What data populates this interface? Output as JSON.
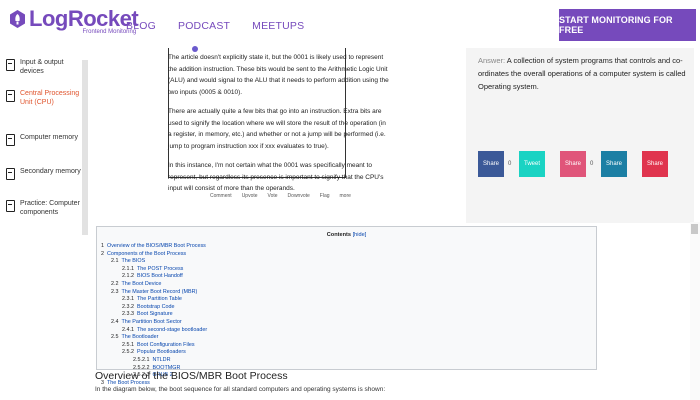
{
  "header": {
    "logo_text": "LogRocket",
    "logo_tagline": "Frontend Monitoring",
    "nav": [
      "BLOG",
      "PODCAST",
      "MEETUPS"
    ],
    "cta_label": "START MONITORING FOR FREE",
    "brand_color": "#764abc"
  },
  "sidebar": {
    "items": [
      {
        "label": "Input & output devices",
        "active": false
      },
      {
        "label": "Central Processing Unit (CPU)",
        "active": true
      },
      {
        "label": "Computer memory",
        "active": false
      },
      {
        "label": "Secondary memory",
        "active": false
      },
      {
        "label": "Practice: Computer components",
        "active": false
      }
    ],
    "icon": "document-icon",
    "active_color": "#e0552e"
  },
  "document": {
    "paragraphs": [
      "The article doesn't explicitly state it, but the 0001 is likely used to represent the addition instruction. These bits would be sent to the Arithmetic Logic Unit (ALU) and would signal to the ALU that it needs to perform addition using the two inputs (0005 & 0010).",
      "There are actually quite a few bits that go into an instruction. Extra bits are used to signify the location where we will store the result of the operation (in a register, in memory, etc.) and whether or not a jump will be performed (i.e. jump to program instruction xxx if xxx evaluates to true).",
      "In this instance, I'm not certain what the 0001 was specifically meant to represent, but regardless its presence is important to signify that the CPU's input will consist of more than the operands."
    ],
    "toolbar": [
      "Comment",
      "Upvote",
      "Vote",
      "Downvote",
      "Flag",
      "more"
    ]
  },
  "answer": {
    "label": "Answer:",
    "text": "A collection of system programs that controls and co-ordinates the overall operations of a computer system is called Operating system."
  },
  "share": {
    "buttons": [
      {
        "label": "Share",
        "count": "0",
        "color": "#3b5998"
      },
      {
        "label": "Tweet",
        "count": "",
        "color": "#1ad3c3"
      },
      {
        "label": "Share",
        "count": "0",
        "color": "#e0557a"
      },
      {
        "label": "Share",
        "count": "",
        "color": "#1c7fa4"
      },
      {
        "label": "Share",
        "count": "",
        "color": "#e0344e"
      }
    ]
  },
  "toc": {
    "title": "Contents",
    "hide_label": "[hide]",
    "entries": [
      {
        "num": "1",
        "text": "Overview of the BIOS/MBR Boot Process",
        "level": 0
      },
      {
        "num": "2",
        "text": "Components of the Boot Process",
        "level": 0
      },
      {
        "num": "2.1",
        "text": "The BIOS",
        "level": 1
      },
      {
        "num": "2.1.1",
        "text": "The POST Process",
        "level": 2
      },
      {
        "num": "2.1.2",
        "text": "BIOS Boot Handoff",
        "level": 2
      },
      {
        "num": "2.2",
        "text": "The Boot Device",
        "level": 1
      },
      {
        "num": "2.3",
        "text": "The Master Boot Record (MBR)",
        "level": 1
      },
      {
        "num": "2.3.1",
        "text": "The Partition Table",
        "level": 2
      },
      {
        "num": "2.3.2",
        "text": "Bootstrap Code",
        "level": 2
      },
      {
        "num": "2.3.3",
        "text": "Boot Signature",
        "level": 2
      },
      {
        "num": "2.4",
        "text": "The Partition Boot Sector",
        "level": 1
      },
      {
        "num": "2.4.1",
        "text": "The second-stage bootloader",
        "level": 2
      },
      {
        "num": "2.5",
        "text": "The Bootloader",
        "level": 1
      },
      {
        "num": "2.5.1",
        "text": "Boot Configuration Files",
        "level": 2
      },
      {
        "num": "2.5.2",
        "text": "Popular Bootloaders",
        "level": 2
      },
      {
        "num": "2.5.2.1",
        "text": "NTLDR",
        "level": 3
      },
      {
        "num": "2.5.2.2",
        "text": "BOOTMGR",
        "level": 3
      },
      {
        "num": "2.5.2.3",
        "text": "GRUB 2",
        "level": 3
      },
      {
        "num": "3",
        "text": "The Boot Process",
        "level": 0
      }
    ]
  },
  "overlay": {
    "heading": "Overview of the BIOS/MBR Boot Process",
    "body": "In the diagram below, the boot sequence for all standard computers and operating systems is shown:"
  }
}
